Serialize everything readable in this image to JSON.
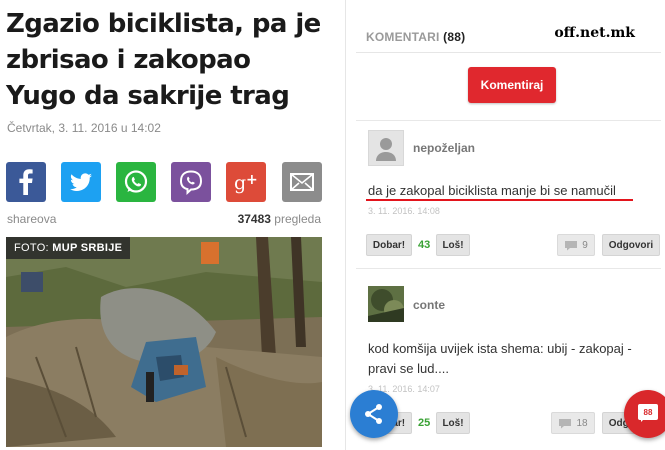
{
  "article": {
    "headline": "Zgazio biciklista, pa je zbrisao i zakopao Yugo da sakrije trag",
    "date": "Četvrtak, 3. 11. 2016 u 14:02",
    "share_label": "shareova",
    "views_count": "37483",
    "views_label": "pregleda",
    "photo_caption_prefix": "FOTO:",
    "photo_caption_source": "MUP SRBIJE",
    "share_buttons": [
      {
        "name": "facebook",
        "color": "#3b5998",
        "icon": "facebook-icon"
      },
      {
        "name": "twitter",
        "color": "#1da1f2",
        "icon": "twitter-icon"
      },
      {
        "name": "whatsapp",
        "color": "#2ab540",
        "icon": "whatsapp-icon"
      },
      {
        "name": "viber",
        "color": "#7b519d",
        "icon": "viber-icon"
      },
      {
        "name": "googleplus",
        "color": "#dd4b39",
        "icon": "google-plus-icon"
      },
      {
        "name": "email",
        "color": "#8c8c8c",
        "icon": "envelope-icon"
      }
    ]
  },
  "comments": {
    "header_label": "KOMENTARI",
    "header_count": "(88)",
    "watermark": "off.net.mk",
    "komentiraj_label": "Komentiraj",
    "items": [
      {
        "username": "nepoželjan",
        "text": "da je zakopal biciklista manje bi se namučil",
        "date": "3. 11. 2016.   14:08",
        "good_label": "Dobar!",
        "score": "43",
        "bad_label": "Loš!",
        "replies": "9",
        "reply_label": "Odgovori"
      },
      {
        "username": "conte",
        "text_line1": "kod komšija uvijek ista shema: ubij - zakopaj -",
        "text_line2": "pravi se lud....",
        "date": "3. 11. 2016.   14:07",
        "good_label": "Dobar!",
        "score": "25",
        "bad_label": "Loš!",
        "replies": "18",
        "reply_label": "Odgovori"
      }
    ],
    "fab_count": "88"
  },
  "colors": {
    "accent_red": "#e0282e",
    "share_fab": "#2b7ed3",
    "score_green": "#3aa235"
  }
}
